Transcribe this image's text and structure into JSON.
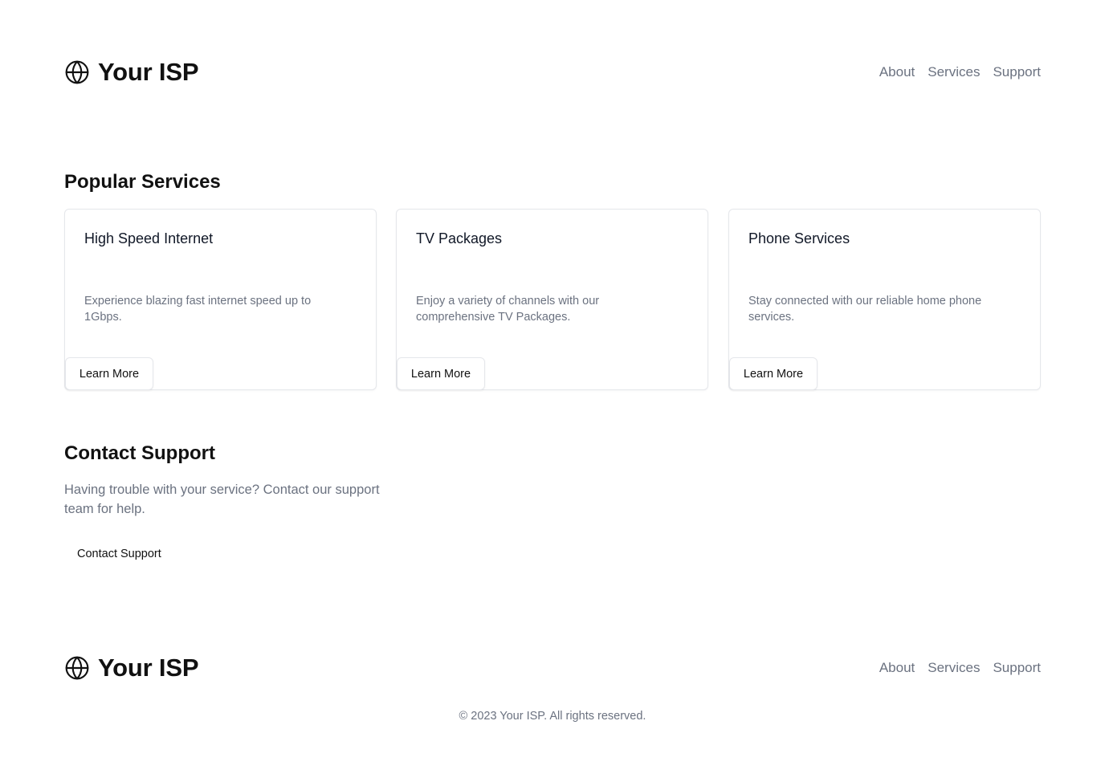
{
  "header": {
    "brand_name": "Your ISP",
    "brand_icon": "globe-icon",
    "nav": [
      {
        "label": "About"
      },
      {
        "label": "Services"
      },
      {
        "label": "Support"
      }
    ]
  },
  "services": {
    "title": "Popular Services",
    "cards": [
      {
        "title": "High Speed Internet",
        "description": "Experience blazing fast internet speed up to 1Gbps.",
        "button_label": "Learn More"
      },
      {
        "title": "TV Packages",
        "description": "Enjoy a variety of channels with our comprehensive TV Packages.",
        "button_label": "Learn More"
      },
      {
        "title": "Phone Services",
        "description": "Stay connected with our reliable home phone services.",
        "button_label": "Learn More"
      }
    ]
  },
  "support": {
    "title": "Contact Support",
    "text": "Having trouble with your service? Contact our support team for help.",
    "button_label": "Contact Support"
  },
  "footer": {
    "brand_name": "Your ISP",
    "brand_icon": "globe-icon",
    "nav": [
      {
        "label": "About"
      },
      {
        "label": "Services"
      },
      {
        "label": "Support"
      }
    ],
    "copyright": "© 2023 Your ISP. All rights reserved."
  },
  "colors": {
    "text_primary": "#111111",
    "text_muted": "#6b7280",
    "border": "#e5e7eb",
    "background": "#ffffff"
  }
}
